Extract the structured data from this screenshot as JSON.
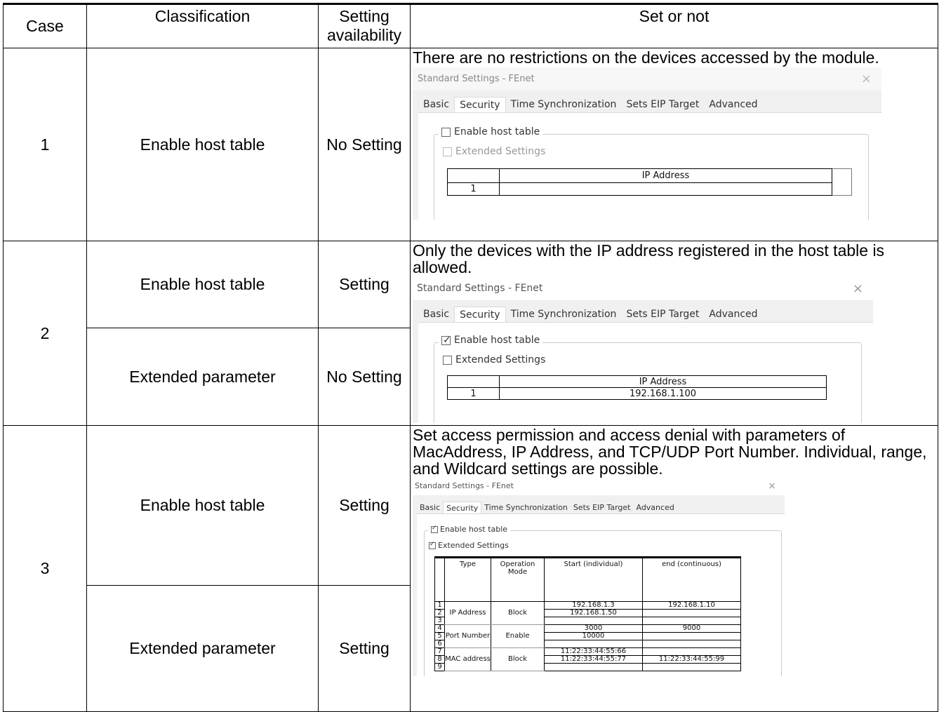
{
  "header": {
    "case": "Case",
    "classification": "Classification",
    "setting_availability_line1": "Setting",
    "setting_availability_line2": "availability",
    "set_or_not": "Set or not"
  },
  "rows": [
    {
      "case": "1",
      "classification": "Enable host table",
      "availability": "No Setting",
      "description": "There are no restrictions on the devices accessed by the module."
    },
    {
      "case": "2",
      "classification_a": "Enable host table",
      "availability_a": "Setting",
      "classification_b": "Extended parameter",
      "availability_b": "No Setting",
      "description": "Only the devices with the IP address registered in the host table is allowed."
    },
    {
      "case": "3",
      "classification_a": "Enable host table",
      "availability_a": "Setting",
      "classification_b": "Extended parameter",
      "availability_b": "Setting",
      "description": "Set access permission and access denial with parameters of MacAddress, IP Address, and TCP/UDP Port Number. Individual, range, and Wildcard settings are possible."
    }
  ],
  "dialog": {
    "title": "Standard Settings - FEnet",
    "close": "×",
    "tabs": [
      "Basic",
      "Security",
      "Time Synchronization",
      "Sets EIP Target",
      "Advanced"
    ],
    "enable_host_table": "Enable host table",
    "extended_settings": "Extended Settings",
    "ip_address_header": "IP Address"
  },
  "dialog1": {
    "enable_checked": false,
    "row_no": "1",
    "ip": ""
  },
  "dialog2": {
    "enable_checked": true,
    "extended_checked": false,
    "row_no": "1",
    "ip": "192.168.1.100"
  },
  "dialog3": {
    "enable_checked": true,
    "extended_checked": true,
    "headers": {
      "type": "Type",
      "mode": "Operation Mode",
      "start": "Start (individual)",
      "end": "end (continuous)"
    },
    "groups": [
      {
        "type": "IP Address",
        "mode": "Block",
        "rows": [
          {
            "no": "1",
            "start": "192.168.1.3",
            "end": "192.168.1.10"
          },
          {
            "no": "2",
            "start": "192.168.1.50",
            "end": ""
          },
          {
            "no": "3",
            "start": "",
            "end": ""
          }
        ]
      },
      {
        "type": "Port Number",
        "mode": "Enable",
        "rows": [
          {
            "no": "4",
            "start": "3000",
            "end": "9000"
          },
          {
            "no": "5",
            "start": "10000",
            "end": ""
          },
          {
            "no": "6",
            "start": "",
            "end": ""
          }
        ]
      },
      {
        "type": "MAC address",
        "mode": "Block",
        "rows": [
          {
            "no": "7",
            "start": "11:22:33:44:55:66",
            "end": ""
          },
          {
            "no": "8",
            "start": "11:22:33:44:55:77",
            "end": "11:22:33:44:55:99"
          },
          {
            "no": "9",
            "start": "",
            "end": ""
          }
        ]
      }
    ]
  }
}
